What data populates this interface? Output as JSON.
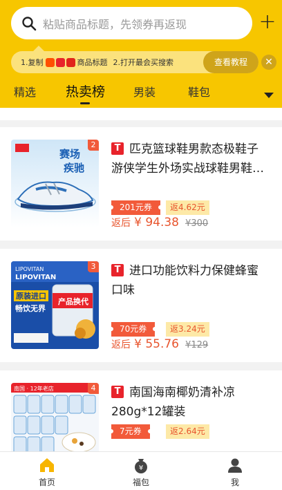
{
  "search": {
    "placeholder": "粘贴商品标题，先领券再返现"
  },
  "tip": {
    "step1": "1.复制",
    "step1_suffix": "商品标题",
    "step2": "2.打开最会买搜索",
    "button": "查看教程"
  },
  "tabs": {
    "items": [
      "精选",
      "热卖榜",
      "男装",
      "鞋包"
    ],
    "active": "热卖榜"
  },
  "products": [
    {
      "rank": "2",
      "title": "匹克篮球鞋男款态极鞋子游侠学生外场实战球鞋男鞋…",
      "title_line1": "匹克篮球鞋男款态极鞋子",
      "title_line2": "游侠学生外场实战球鞋男鞋…",
      "coupon": "201元券",
      "rebate": "返4.62元",
      "price_label": "返后",
      "price": "¥ 94.38",
      "orig_price": "¥300"
    },
    {
      "rank": "3",
      "title_line1": "进口功能饮料力保健蜂蜜",
      "title_line2": "口味",
      "coupon": "70元券",
      "rebate": "返3.24元",
      "price_label": "返后",
      "price": "¥ 55.76",
      "orig_price": "¥129"
    },
    {
      "rank": "4",
      "title_line1": "南国海南椰奶清补凉",
      "title_line2": "280g*12罐装",
      "coupon": "7元券",
      "rebate": "返2.64元"
    }
  ],
  "nav": {
    "home": "首页",
    "fubao": "福包",
    "me": "我"
  },
  "colors": {
    "brand": "#f7c600",
    "accent": "#f25a3a",
    "rebate_bg": "#fde9a7"
  }
}
